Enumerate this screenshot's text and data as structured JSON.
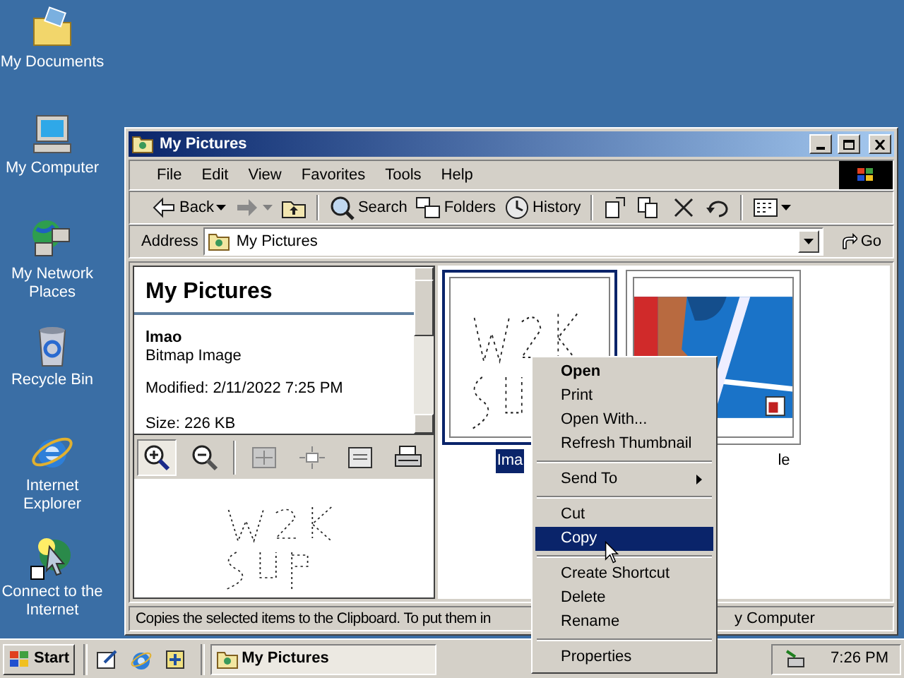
{
  "desktop_icons": [
    {
      "kind": "documents",
      "label": "My Documents"
    },
    {
      "kind": "computer",
      "label": "My Computer"
    },
    {
      "kind": "network",
      "label": "My Network Places"
    },
    {
      "kind": "recycle",
      "label": "Recycle Bin"
    },
    {
      "kind": "ie",
      "label": "Internet Explorer"
    },
    {
      "kind": "connect",
      "label": "Connect to the Internet"
    }
  ],
  "window": {
    "title": "My Pictures",
    "menu": [
      "File",
      "Edit",
      "View",
      "Favorites",
      "Tools",
      "Help"
    ],
    "toolbar": [
      {
        "kind": "back",
        "label": "Back",
        "dropdown": true,
        "disabled": false
      },
      {
        "kind": "forward",
        "dropdown": true,
        "disabled": true
      },
      {
        "kind": "up",
        "disabled": false
      },
      {
        "kind": "sep"
      },
      {
        "kind": "search",
        "label": "Search",
        "disabled": false
      },
      {
        "kind": "folders",
        "label": "Folders",
        "disabled": false
      },
      {
        "kind": "history",
        "label": "History",
        "disabled": false
      },
      {
        "kind": "sep"
      },
      {
        "kind": "moveto",
        "disabled": false
      },
      {
        "kind": "copyto",
        "disabled": false
      },
      {
        "kind": "delete",
        "disabled": false
      },
      {
        "kind": "undo",
        "disabled": false
      },
      {
        "kind": "sep"
      },
      {
        "kind": "views",
        "dropdown": true,
        "disabled": false
      }
    ],
    "address": {
      "label": "Address",
      "value": "My Pictures",
      "go": "Go"
    },
    "info_pane": {
      "title": "My Pictures",
      "file_name": "lmao",
      "file_type": "Bitmap Image",
      "modified": "Modified: 2/11/2022 7:25 PM",
      "size": "Size: 226 KB"
    },
    "preview_tools": [
      {
        "kind": "zoomin",
        "selected": true
      },
      {
        "kind": "zoomout",
        "selected": false
      },
      {
        "kind": "sep"
      },
      {
        "kind": "bestfit",
        "selected": false
      },
      {
        "kind": "actual",
        "selected": false
      },
      {
        "kind": "slideshow",
        "selected": false
      },
      {
        "kind": "print",
        "selected": false
      }
    ],
    "thumbnails": [
      {
        "kind": "scribble",
        "label": "Ima",
        "selected": true
      },
      {
        "label": "le",
        "selected": false
      }
    ],
    "status_bar": {
      "text": "Copies the selected items to the Clipboard. To put them in",
      "zone": "y Computer"
    }
  },
  "context_menu": [
    {
      "kind": "default",
      "label": "Open",
      "selected": false
    },
    {
      "kind": "item",
      "label": "Print",
      "selected": false
    },
    {
      "kind": "item",
      "label": "Open With...",
      "selected": false
    },
    {
      "kind": "item",
      "label": "Refresh Thumbnail",
      "selected": false
    },
    {
      "kind": "separator"
    },
    {
      "kind": "submenu",
      "label": "Send To",
      "selected": false
    },
    {
      "kind": "separator"
    },
    {
      "kind": "item",
      "label": "Cut",
      "selected": false
    },
    {
      "kind": "item",
      "label": "Copy",
      "selected": true
    },
    {
      "kind": "separator"
    },
    {
      "kind": "item",
      "label": "Create Shortcut",
      "selected": false
    },
    {
      "kind": "item",
      "label": "Delete",
      "selected": false
    },
    {
      "kind": "item",
      "label": "Rename",
      "selected": false
    },
    {
      "kind": "separator"
    },
    {
      "kind": "item",
      "label": "Properties",
      "selected": false
    }
  ],
  "taskbar": {
    "start": "Start",
    "quick_launch": [
      {
        "kind": "desktop"
      },
      {
        "kind": "ie"
      },
      {
        "kind": "channels"
      }
    ],
    "tasks": [
      {
        "label": "My Pictures",
        "selected": true
      }
    ],
    "clock": "7:26 PM"
  }
}
